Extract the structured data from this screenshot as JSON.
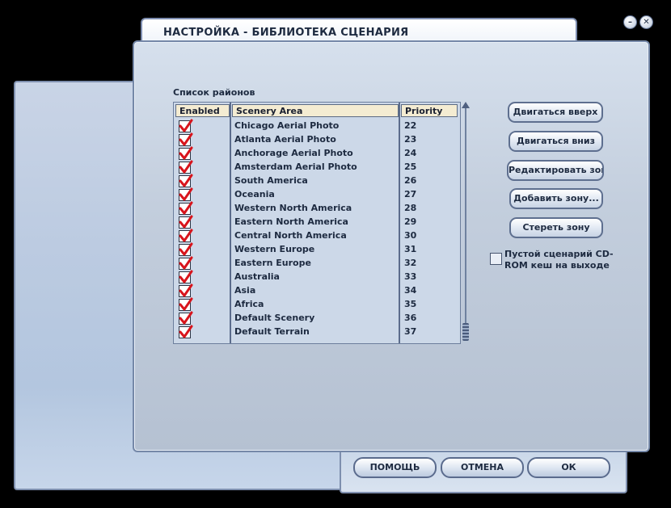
{
  "window": {
    "title": "НАСТРОЙКА  -  БИБЛИОТЕКА СЦЕНАРИЯ",
    "minimize_icon": "minus-icon",
    "close_icon": "close-icon"
  },
  "list": {
    "label": "Список районов",
    "columns": {
      "enabled": "Enabled",
      "area": "Scenery Area",
      "priority": "Priority"
    },
    "rows": [
      {
        "enabled": true,
        "area": "Chicago Aerial Photo",
        "priority": "22"
      },
      {
        "enabled": true,
        "area": "Atlanta Aerial Photo",
        "priority": "23"
      },
      {
        "enabled": true,
        "area": "Anchorage Aerial Photo",
        "priority": "24"
      },
      {
        "enabled": true,
        "area": "Amsterdam Aerial Photo",
        "priority": "25"
      },
      {
        "enabled": true,
        "area": "South America",
        "priority": "26"
      },
      {
        "enabled": true,
        "area": "Oceania",
        "priority": "27"
      },
      {
        "enabled": true,
        "area": "Western North America",
        "priority": "28"
      },
      {
        "enabled": true,
        "area": "Eastern North America",
        "priority": "29"
      },
      {
        "enabled": true,
        "area": "Central North America",
        "priority": "30"
      },
      {
        "enabled": true,
        "area": "Western Europe",
        "priority": "31"
      },
      {
        "enabled": true,
        "area": "Eastern Europe",
        "priority": "32"
      },
      {
        "enabled": true,
        "area": "Australia",
        "priority": "33"
      },
      {
        "enabled": true,
        "area": "Asia",
        "priority": "34"
      },
      {
        "enabled": true,
        "area": "Africa",
        "priority": "35"
      },
      {
        "enabled": true,
        "area": "Default Scenery",
        "priority": "36"
      },
      {
        "enabled": true,
        "area": "Default Terrain",
        "priority": "37"
      }
    ]
  },
  "actions": {
    "move_up": "Двигаться вверх",
    "move_down": "Двигаться вниз",
    "edit_area": "Редактировать зону...",
    "add_area": "Добавить зону...",
    "delete_area": "Стереть зону"
  },
  "cdrom_cache": {
    "checked": false,
    "label": "Пустой сценарий CD-ROM кеш на выходе"
  },
  "footer": {
    "help": "ПОМОЩЬ",
    "cancel": "ОТМЕНА",
    "ok": "ОК"
  },
  "colors": {
    "check_mark": "#d8141c",
    "header_bg": "#f4ecd2",
    "panel_border": "#7588a8"
  }
}
